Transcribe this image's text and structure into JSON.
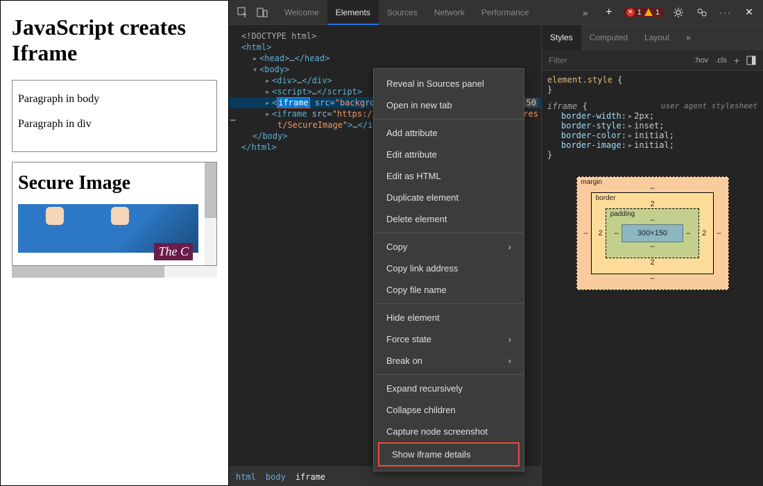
{
  "page": {
    "heading": "JavaScript creates Iframe",
    "para1": "Paragraph in body",
    "para2": "Paragraph in div",
    "iframeHeading": "Secure Image",
    "iframeBadge": "The C"
  },
  "tabs": {
    "welcome": "Welcome",
    "elements": "Elements",
    "sources": "Sources",
    "network": "Network",
    "performance": "Performance"
  },
  "toolbar": {
    "errCount": "1",
    "warnCount": "1"
  },
  "dom": {
    "doctype": "<!DOCTYPE html>",
    "htmlOpen": "<html>",
    "headOpen": "<head>",
    "headClose": "</head>",
    "bodyOpen": "<body>",
    "divOpen": "<div>",
    "divEllipsis": "…",
    "divClose": "</div>",
    "scriptOpen": "<script>",
    "scriptEll": "…",
    "scriptClose": "</script>",
    "iframeTag": "iframe",
    "iframeAttrName": " src=",
    "iframeAttrVal": "\"backgrou",
    "iframe2a": "<iframe",
    "iframe2b": " src=",
    "iframe2c": "\"https://",
    "iframe2dPath": "t/SecureImage\"",
    "iframe2e": ">",
    "iframe2ell": "…",
    "iframe2close": "</ifram",
    "bodyClose": "</body>",
    "htmlClose": "</html>",
    "dimBadge": "50",
    "lineEndTxt": "res"
  },
  "crumbs": {
    "html": "html",
    "body": "body",
    "iframe": "iframe"
  },
  "stylesTabs": {
    "styles": "Styles",
    "computed": "Computed",
    "layout": "Layout"
  },
  "filter": {
    "placeholder": "Filter",
    "hov": ":hov",
    "cls": ".cls"
  },
  "rules": {
    "elStyle": "element.style",
    "iframeSel": "iframe",
    "uaLabel": "user agent stylesheet",
    "p1n": "border-width",
    "p1v": "2px;",
    "p2n": "border-style",
    "p2v": "inset;",
    "p3n": "border-color",
    "p3v": "initial;",
    "p4n": "border-image",
    "p4v": "initial;"
  },
  "boxModel": {
    "margin": "margin",
    "border": "border",
    "padding": "padding",
    "content": "300×150",
    "marginV": "–",
    "borderV": "2",
    "paddingV": "–"
  },
  "ctx": {
    "reveal": "Reveal in Sources panel",
    "openNew": "Open in new tab",
    "addAttr": "Add attribute",
    "editAttr": "Edit attribute",
    "editHtml": "Edit as HTML",
    "dup": "Duplicate element",
    "del": "Delete element",
    "copy": "Copy",
    "copyLink": "Copy link address",
    "copyFile": "Copy file name",
    "hide": "Hide element",
    "force": "Force state",
    "breakOn": "Break on",
    "expand": "Expand recursively",
    "collapse": "Collapse children",
    "capture": "Capture node screenshot",
    "showIframe": "Show iframe details"
  }
}
